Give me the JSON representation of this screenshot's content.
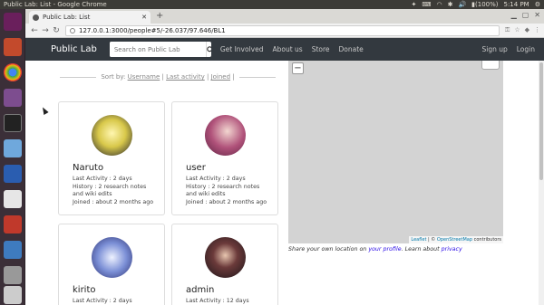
{
  "os": {
    "window_title": "Public Lab: List - Google Chrome",
    "battery": "(100%)",
    "clock": "5:14 PM"
  },
  "browser": {
    "tab_title": "Public Lab: List",
    "new_tab": "+",
    "url": "127.0.0.1:3000/people#5/-26.037/97.646/BL1",
    "back": "←",
    "forward": "→",
    "reload": "↻"
  },
  "nav": {
    "brand": "Public Lab",
    "search_placeholder": "Search on Public Lab",
    "links": [
      "Get Involved",
      "About us",
      "Store",
      "Donate"
    ],
    "signup": "Sign up",
    "login": "Login"
  },
  "sort": {
    "prefix": "Sort by:",
    "options": [
      "Username",
      "Last activity",
      "Joined"
    ],
    "sep": "|"
  },
  "users": [
    {
      "name": "Naruto",
      "last_activity": "Last Activity : 2 days",
      "history": "History : 2 research notes and wiki edits",
      "joined": "Joined : about 2 months ago",
      "avatar_color": "#d8c84a"
    },
    {
      "name": "user",
      "last_activity": "Last Activity : 2 days",
      "history": "History : 2 research notes and wiki edits",
      "joined": "Joined : about 2 months ago",
      "avatar_color": "#b0527a"
    },
    {
      "name": "kirito",
      "last_activity": "Last Activity : 2 days",
      "history": "",
      "joined": "",
      "avatar_color": "#7b8fd6"
    },
    {
      "name": "admin",
      "last_activity": "Last Activity : 12 days",
      "history": "",
      "joined": "",
      "avatar_color": "#3a2a2e"
    }
  ],
  "map": {
    "zoom_out": "−",
    "attribution_leaflet": "Leaflet",
    "attribution_sep": " | © ",
    "attribution_osm": "OpenStreetMap",
    "attribution_rest": " contributors",
    "note_prefix": "Share your own location on ",
    "note_link1": "your profile",
    "note_mid": ". Learn about ",
    "note_link2": "privacy"
  },
  "colors": {
    "navbar": "#33393f",
    "map_bg": "#d3d3d3",
    "launcher": "#3b2f38",
    "link": "#2a0be6"
  }
}
